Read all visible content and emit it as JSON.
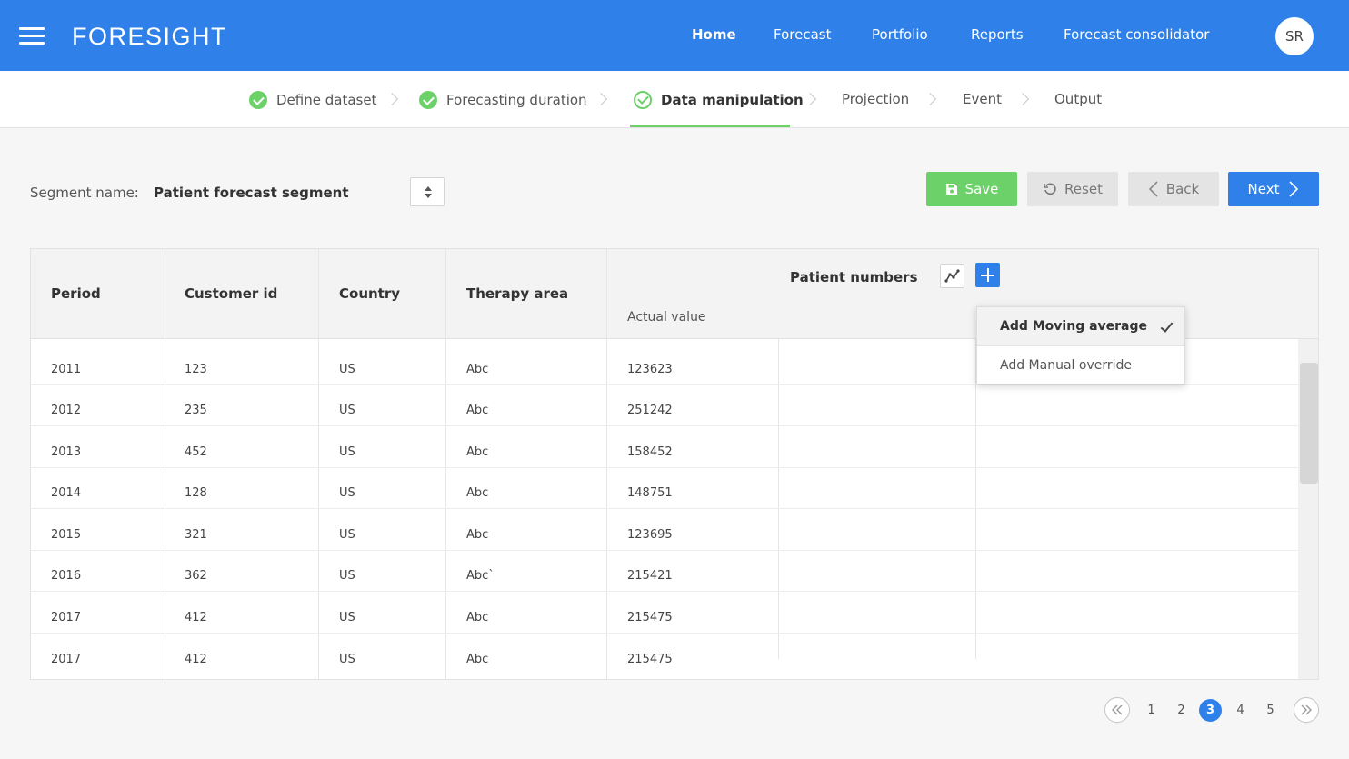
{
  "app": {
    "brand": "FORESIGHT"
  },
  "nav": {
    "items": [
      {
        "label": "Home",
        "active": true
      },
      {
        "label": "Forecast"
      },
      {
        "label": "Portfolio"
      },
      {
        "label": "Reports"
      },
      {
        "label": "Forecast consolidator"
      }
    ],
    "avatar_initials": "SR"
  },
  "steps": [
    {
      "label": "Define dataset",
      "status": "done"
    },
    {
      "label": "Forecasting duration",
      "status": "done"
    },
    {
      "label": "Data manipulation",
      "status": "current"
    },
    {
      "label": "Projection",
      "status": "pending"
    },
    {
      "label": "Event",
      "status": "pending"
    },
    {
      "label": "Output",
      "status": "pending"
    }
  ],
  "segment": {
    "label": "Segment name:",
    "value": "Patient forecast segment"
  },
  "toolbar": {
    "save_label": "Save",
    "reset_label": "Reset",
    "back_label": "Back",
    "next_label": "Next"
  },
  "table": {
    "columns": {
      "period": "Period",
      "customer_id": "Customer id",
      "country": "Country",
      "therapy_area": "Therapy area",
      "group": "Patient numbers",
      "actual_value": "Actual value"
    },
    "rows": [
      [
        "2011",
        "123",
        "US",
        "Abc",
        "123623"
      ],
      [
        "2012",
        "235",
        "US",
        "Abc",
        "251242"
      ],
      [
        "2013",
        "452",
        "US",
        "Abc",
        "158452"
      ],
      [
        "2014",
        "128",
        "US",
        "Abc",
        "148751"
      ],
      [
        "2015",
        "321",
        "US",
        "Abc",
        "123695"
      ],
      [
        "2016",
        "362",
        "US",
        "Abc`",
        "215421"
      ],
      [
        "2017",
        "412",
        "US",
        "Abc",
        "215475"
      ],
      [
        "2017",
        "412",
        "US",
        "Abc",
        "215475"
      ]
    ]
  },
  "dropdown": {
    "items": [
      "Add Moving average",
      "Add Manual override"
    ],
    "selected": "Add Moving average"
  },
  "pagination": {
    "pages": [
      "1",
      "2",
      "3",
      "4",
      "5"
    ],
    "current": "3"
  },
  "colors": {
    "primary": "#2f80e8",
    "success": "#6dd16a",
    "muted": "#e4e4e4"
  }
}
